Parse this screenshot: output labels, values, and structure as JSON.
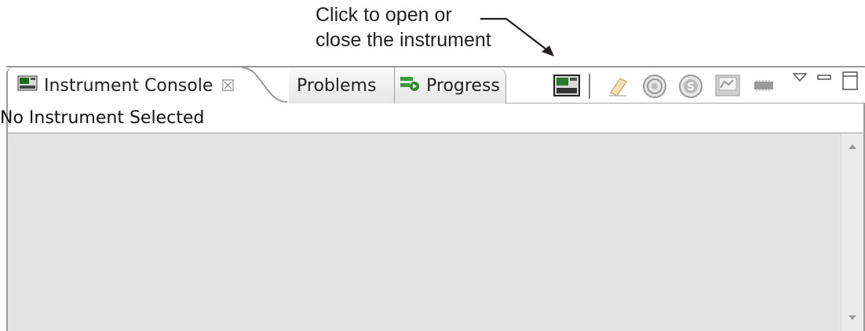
{
  "callout": {
    "line1": "Click to open or",
    "line2": "close the instrument"
  },
  "tabs": [
    {
      "label": "Instrument Console",
      "icon": "instrument-console-icon",
      "active": true,
      "close_glyph": "☒"
    },
    {
      "label": "Problems",
      "icon": "problems-icon",
      "active": false
    },
    {
      "label": "Progress",
      "icon": "progress-icon",
      "active": false
    }
  ],
  "toolbar": {
    "items": [
      "open-close-instrument-icon",
      "clear-console-icon",
      "target-icon",
      "stop-icon",
      "display-icon",
      "memory-icon",
      "view-menu-icon",
      "minimize-icon",
      "maximize-icon"
    ]
  },
  "status": {
    "text": "No Instrument Selected"
  }
}
